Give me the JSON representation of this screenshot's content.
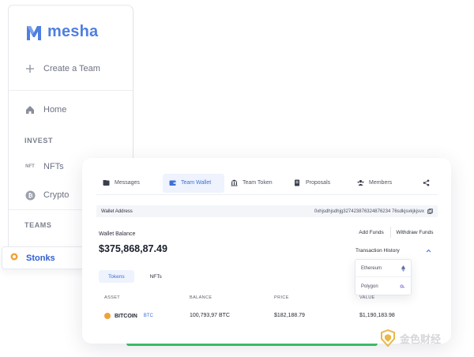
{
  "brand": {
    "name": "mesha"
  },
  "sidebar": {
    "create_team": "Create a Team",
    "home": "Home",
    "invest_heading": "INVEST",
    "nft_badge": "NFT",
    "nfts": "NFTs",
    "crypto": "Crypto",
    "teams_heading": "TEAMS",
    "stonks": "Stonks"
  },
  "tabs": [
    {
      "label": "Messages",
      "icon": "folder-icon"
    },
    {
      "label": "Team Wallet",
      "icon": "wallet-icon",
      "active": true
    },
    {
      "label": "Team Token",
      "icon": "bank-icon"
    },
    {
      "label": "Proposals",
      "icon": "document-icon"
    },
    {
      "label": "Members",
      "icon": "members-icon"
    }
  ],
  "wallet": {
    "address_label": "Wallet Address",
    "address": "0xhjsdhjsdhjg327423876324876234 76sdkjsvkjkjsvx",
    "balance_label": "Wallet Balance",
    "balance": "$375,868,87.49",
    "add_funds": "Add Funds",
    "withdraw_funds": "Withdraw Funds",
    "transaction_history": "Transaction History",
    "networks": [
      "Ethereum",
      "Polygon"
    ]
  },
  "subtabs": [
    "Tokens",
    "NFTs"
  ],
  "table": {
    "columns": [
      "ASSET",
      "BALANCE",
      "PRICE",
      "VALUE"
    ],
    "rows": [
      {
        "asset": "BITCOIN",
        "symbol": "BTC",
        "balance": "100,793,97 BTC",
        "price": "$182,188.79",
        "value": "$1,190,183.98"
      }
    ]
  },
  "watermark": "金色财经",
  "colors": {
    "accent": "#3d6fd8",
    "brand": "#4f7fe0",
    "green": "#3cc768",
    "btc": "#f0a23a"
  }
}
